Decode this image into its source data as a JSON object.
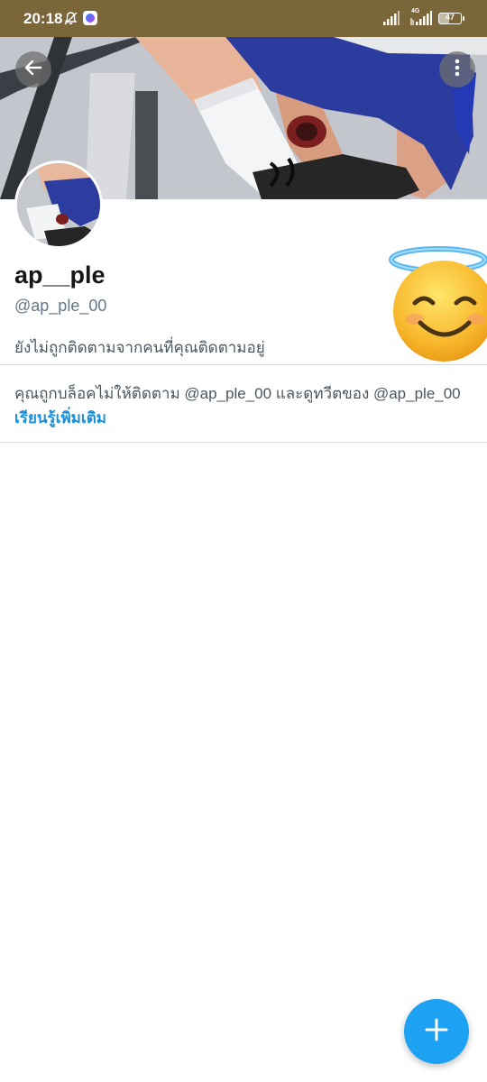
{
  "status_bar": {
    "time": "20:18",
    "network": "4G",
    "battery": "47",
    "icons": [
      "bell-off-icon",
      "messenger-icon",
      "signal-icon",
      "signal-icon",
      "battery-icon"
    ]
  },
  "header": {
    "back_icon": "arrow-left-icon",
    "more_icon": "more-vertical-icon"
  },
  "profile": {
    "display_name": "ap__ple",
    "handle": "@ap_ple_00",
    "follow_status": "ยังไม่ถูกติดตามจากคนที่คุณติดตามอยู่",
    "sticker": "smiling-face-with-halo"
  },
  "blocked_notice": {
    "message": "คุณถูกบล็อคไม่ให้ติดตาม @ap_ple_00 และดูทวีตของ @ap_ple_00",
    "learn_more": "เรียนรู้เพิ่มเติม"
  },
  "fab": {
    "icon": "plus-icon"
  },
  "colors": {
    "status_bar": "#7a6639",
    "accent": "#1da1f2",
    "link": "#1d8fd8",
    "secondary_text": "#657786"
  }
}
